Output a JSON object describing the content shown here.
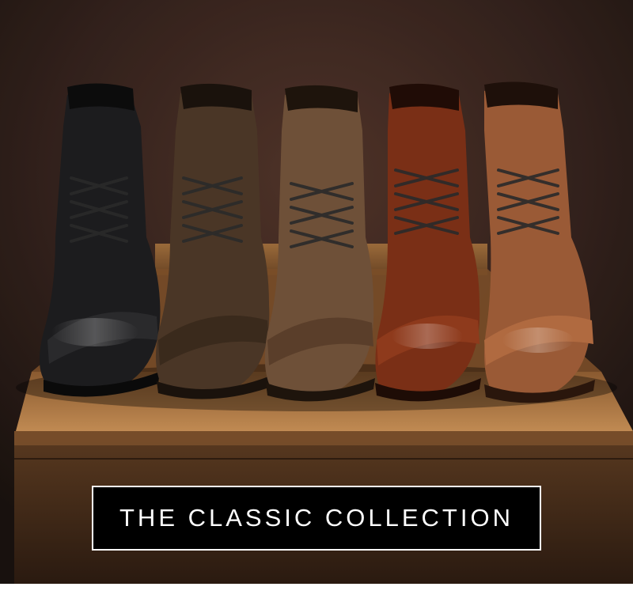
{
  "banner": {
    "title": "THE CLASSIC COLLECTION"
  },
  "colors": {
    "background_wall": "#3a2620",
    "crate_wood": "#a0703e",
    "banner_bg": "#000000",
    "banner_text": "#ffffff",
    "banner_border": "#ffffff"
  },
  "boots": [
    {
      "name": "boot-black-leather",
      "color": "#1c1c1e"
    },
    {
      "name": "boot-dark-brown-suede",
      "color": "#4a3626"
    },
    {
      "name": "boot-tan-suede",
      "color": "#6e5038"
    },
    {
      "name": "boot-cognac-leather",
      "color": "#7a2f16"
    },
    {
      "name": "boot-natural-leather",
      "color": "#9a5a36"
    }
  ]
}
